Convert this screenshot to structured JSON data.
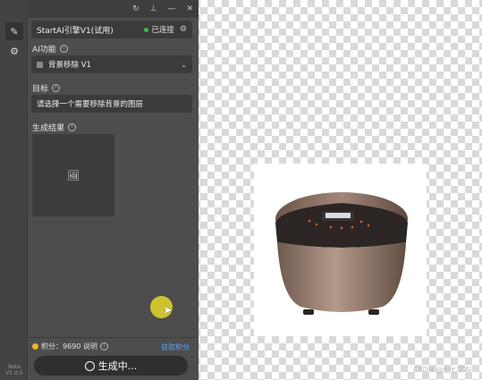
{
  "toolbar": {
    "refresh_icon": "refresh-icon",
    "pin_icon": "pin-icon",
    "minimize_icon": "minimize-icon",
    "close_icon": "close-icon"
  },
  "rail": {
    "edit_icon": "pencil-icon",
    "settings_icon": "gear-icon",
    "beta_label": "Beta",
    "version": "V1.0.5"
  },
  "engine": {
    "name": "StartAI引擎V1(试用)",
    "status": "已连接",
    "status_color": "#2fbf4a"
  },
  "ai_function": {
    "label": "AI功能",
    "selected": "背景移除 V1"
  },
  "target": {
    "label": "目标",
    "value": "请选择一个需要移除背景的图层"
  },
  "result": {
    "label": "生成结果",
    "icon": "image-icon"
  },
  "credits": {
    "text": "积分：9690 说明",
    "link": "获取积分"
  },
  "generate_button": {
    "label": "生成中..."
  },
  "watermark": "CSDN @七七学AI",
  "colors": {
    "panel_bg": "#4d4d4d",
    "accent_link": "#4ea6ff",
    "cursor_highlight": "#e6d828"
  }
}
